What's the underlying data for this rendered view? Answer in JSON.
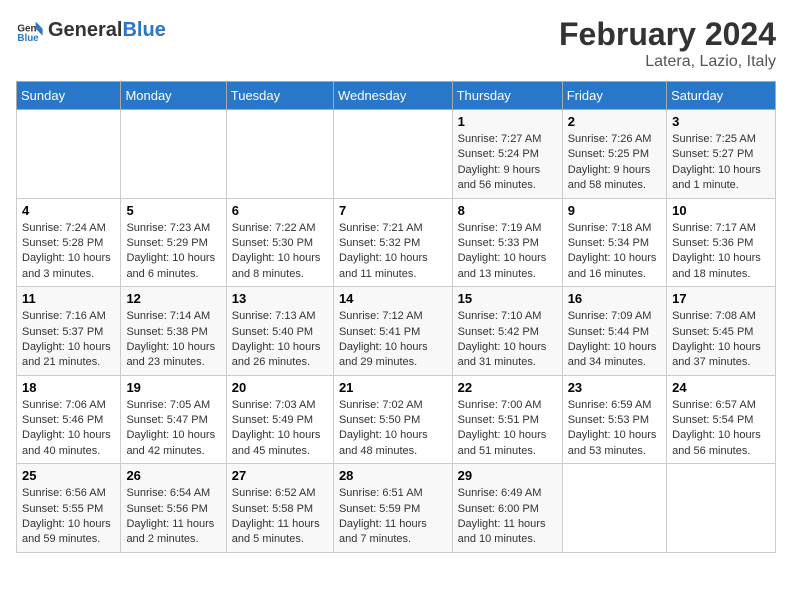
{
  "logo": {
    "general": "General",
    "blue": "Blue"
  },
  "header": {
    "title": "February 2024",
    "subtitle": "Latera, Lazio, Italy"
  },
  "days_of_week": [
    "Sunday",
    "Monday",
    "Tuesday",
    "Wednesday",
    "Thursday",
    "Friday",
    "Saturday"
  ],
  "weeks": [
    {
      "days": [
        {
          "num": "",
          "info": ""
        },
        {
          "num": "",
          "info": ""
        },
        {
          "num": "",
          "info": ""
        },
        {
          "num": "",
          "info": ""
        },
        {
          "num": "1",
          "info": "Sunrise: 7:27 AM\nSunset: 5:24 PM\nDaylight: 9 hours and 56 minutes."
        },
        {
          "num": "2",
          "info": "Sunrise: 7:26 AM\nSunset: 5:25 PM\nDaylight: 9 hours and 58 minutes."
        },
        {
          "num": "3",
          "info": "Sunrise: 7:25 AM\nSunset: 5:27 PM\nDaylight: 10 hours and 1 minute."
        }
      ]
    },
    {
      "days": [
        {
          "num": "4",
          "info": "Sunrise: 7:24 AM\nSunset: 5:28 PM\nDaylight: 10 hours and 3 minutes."
        },
        {
          "num": "5",
          "info": "Sunrise: 7:23 AM\nSunset: 5:29 PM\nDaylight: 10 hours and 6 minutes."
        },
        {
          "num": "6",
          "info": "Sunrise: 7:22 AM\nSunset: 5:30 PM\nDaylight: 10 hours and 8 minutes."
        },
        {
          "num": "7",
          "info": "Sunrise: 7:21 AM\nSunset: 5:32 PM\nDaylight: 10 hours and 11 minutes."
        },
        {
          "num": "8",
          "info": "Sunrise: 7:19 AM\nSunset: 5:33 PM\nDaylight: 10 hours and 13 minutes."
        },
        {
          "num": "9",
          "info": "Sunrise: 7:18 AM\nSunset: 5:34 PM\nDaylight: 10 hours and 16 minutes."
        },
        {
          "num": "10",
          "info": "Sunrise: 7:17 AM\nSunset: 5:36 PM\nDaylight: 10 hours and 18 minutes."
        }
      ]
    },
    {
      "days": [
        {
          "num": "11",
          "info": "Sunrise: 7:16 AM\nSunset: 5:37 PM\nDaylight: 10 hours and 21 minutes."
        },
        {
          "num": "12",
          "info": "Sunrise: 7:14 AM\nSunset: 5:38 PM\nDaylight: 10 hours and 23 minutes."
        },
        {
          "num": "13",
          "info": "Sunrise: 7:13 AM\nSunset: 5:40 PM\nDaylight: 10 hours and 26 minutes."
        },
        {
          "num": "14",
          "info": "Sunrise: 7:12 AM\nSunset: 5:41 PM\nDaylight: 10 hours and 29 minutes."
        },
        {
          "num": "15",
          "info": "Sunrise: 7:10 AM\nSunset: 5:42 PM\nDaylight: 10 hours and 31 minutes."
        },
        {
          "num": "16",
          "info": "Sunrise: 7:09 AM\nSunset: 5:44 PM\nDaylight: 10 hours and 34 minutes."
        },
        {
          "num": "17",
          "info": "Sunrise: 7:08 AM\nSunset: 5:45 PM\nDaylight: 10 hours and 37 minutes."
        }
      ]
    },
    {
      "days": [
        {
          "num": "18",
          "info": "Sunrise: 7:06 AM\nSunset: 5:46 PM\nDaylight: 10 hours and 40 minutes."
        },
        {
          "num": "19",
          "info": "Sunrise: 7:05 AM\nSunset: 5:47 PM\nDaylight: 10 hours and 42 minutes."
        },
        {
          "num": "20",
          "info": "Sunrise: 7:03 AM\nSunset: 5:49 PM\nDaylight: 10 hours and 45 minutes."
        },
        {
          "num": "21",
          "info": "Sunrise: 7:02 AM\nSunset: 5:50 PM\nDaylight: 10 hours and 48 minutes."
        },
        {
          "num": "22",
          "info": "Sunrise: 7:00 AM\nSunset: 5:51 PM\nDaylight: 10 hours and 51 minutes."
        },
        {
          "num": "23",
          "info": "Sunrise: 6:59 AM\nSunset: 5:53 PM\nDaylight: 10 hours and 53 minutes."
        },
        {
          "num": "24",
          "info": "Sunrise: 6:57 AM\nSunset: 5:54 PM\nDaylight: 10 hours and 56 minutes."
        }
      ]
    },
    {
      "days": [
        {
          "num": "25",
          "info": "Sunrise: 6:56 AM\nSunset: 5:55 PM\nDaylight: 10 hours and 59 minutes."
        },
        {
          "num": "26",
          "info": "Sunrise: 6:54 AM\nSunset: 5:56 PM\nDaylight: 11 hours and 2 minutes."
        },
        {
          "num": "27",
          "info": "Sunrise: 6:52 AM\nSunset: 5:58 PM\nDaylight: 11 hours and 5 minutes."
        },
        {
          "num": "28",
          "info": "Sunrise: 6:51 AM\nSunset: 5:59 PM\nDaylight: 11 hours and 7 minutes."
        },
        {
          "num": "29",
          "info": "Sunrise: 6:49 AM\nSunset: 6:00 PM\nDaylight: 11 hours and 10 minutes."
        },
        {
          "num": "",
          "info": ""
        },
        {
          "num": "",
          "info": ""
        }
      ]
    }
  ]
}
